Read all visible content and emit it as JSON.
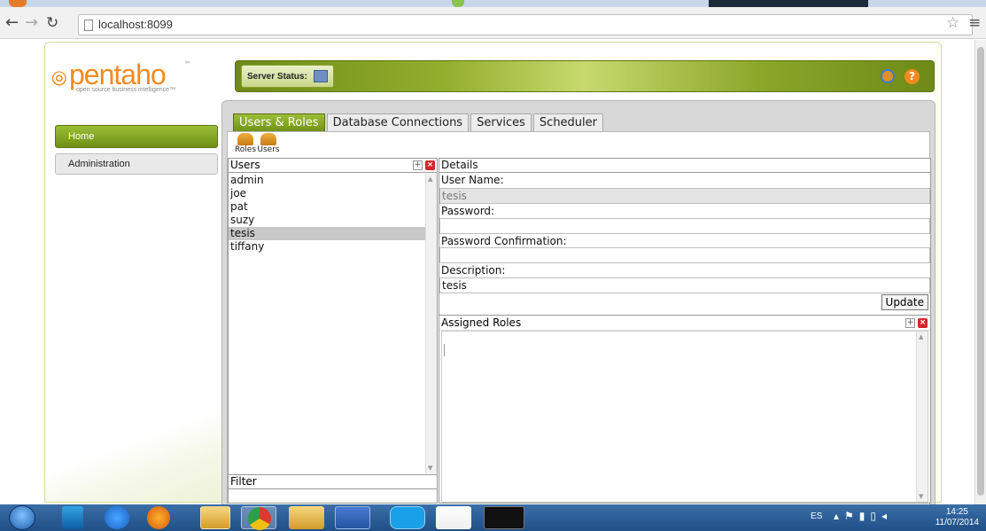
{
  "browser": {
    "url": "localhost:8099",
    "back_icon": "back-arrow",
    "forward_icon": "forward-arrow",
    "reload_icon": "reload",
    "star_icon": "bookmark-star",
    "menu_icon": "hamburger-menu"
  },
  "app": {
    "logo_text": "pentaho",
    "logo_tm": "™",
    "logo_tagline": "open source business intelligence™",
    "header": {
      "server_status_label": "Server Status:",
      "help_symbol": "?"
    },
    "sidenav": {
      "items": [
        {
          "label": "Home",
          "active": true
        },
        {
          "label": "Administration",
          "active": false
        }
      ]
    },
    "tabs": [
      {
        "label": "Users & Roles",
        "active": true
      },
      {
        "label": "Database Connections",
        "active": false
      },
      {
        "label": "Services",
        "active": false
      },
      {
        "label": "Scheduler",
        "active": false
      }
    ],
    "subtoolbar": {
      "roles_label": "Roles",
      "users_label": "Users"
    },
    "users": {
      "header": "Users",
      "items": [
        "admin",
        "joe",
        "pat",
        "suzy",
        "tesis",
        "tiffany"
      ],
      "selected": "tesis",
      "filter_label": "Filter",
      "filter_value": ""
    },
    "details": {
      "header": "Details",
      "user_name_label": "User Name:",
      "user_name_value": "tesis",
      "password_label": "Password:",
      "password_value": "",
      "password_confirm_label": "Password Confirmation:",
      "password_confirm_value": "",
      "description_label": "Description:",
      "description_value": "tesis",
      "update_label": "Update",
      "assigned_roles_label": "Assigned Roles",
      "assigned_roles": []
    }
  },
  "taskbar": {
    "language": "ES",
    "time": "14:25",
    "date": "11/07/2014",
    "apps": [
      "start",
      "media-center",
      "internet-explorer",
      "firefox",
      "file-explorer",
      "chrome",
      "windows-explorer",
      "word",
      "skype",
      "java",
      "command-prompt"
    ]
  },
  "colors": {
    "accent_green": "#7a9a1f",
    "brand_orange": "#f28a1f",
    "remove_red": "#d3262a"
  }
}
